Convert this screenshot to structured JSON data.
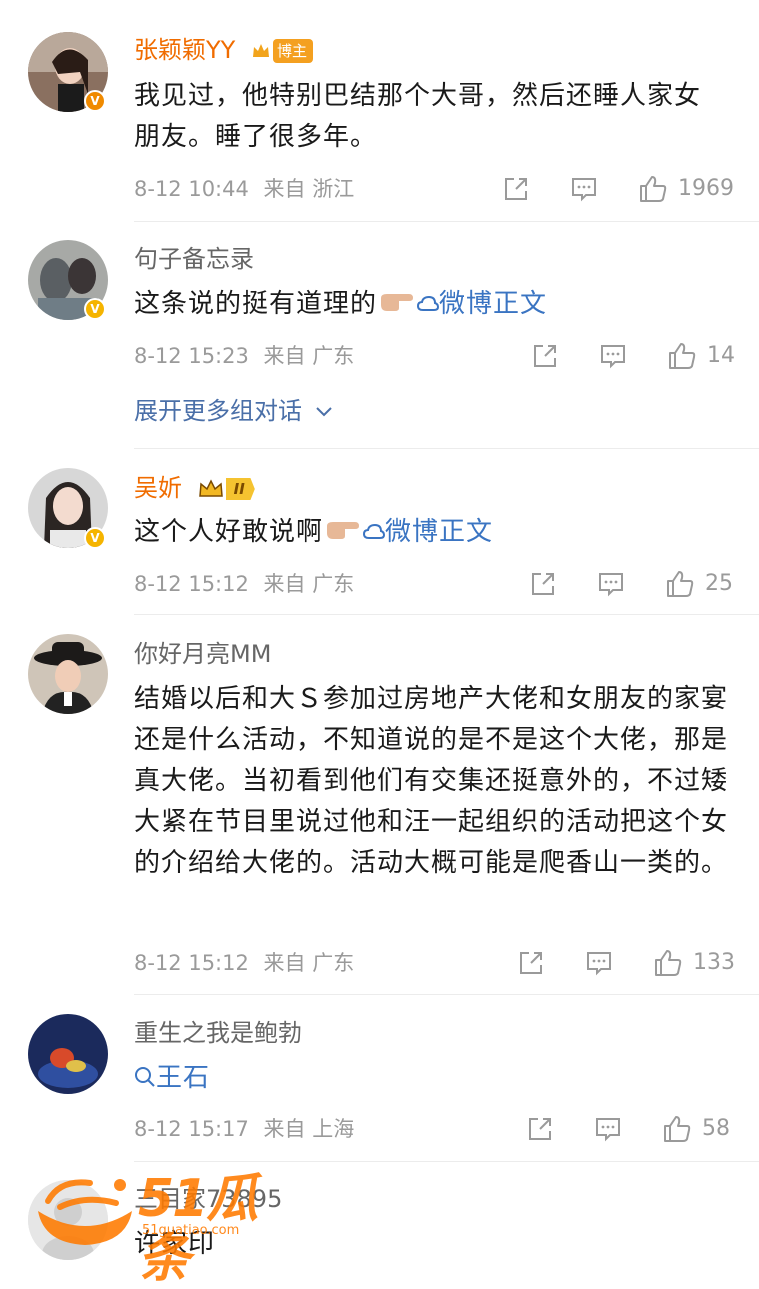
{
  "comments": [
    {
      "name": "张颖颖YY",
      "badge_tag": "博主",
      "text": "我见过，他特别巴结那个大哥，然后还睡人家女朋友。睡了很多年。",
      "time": "8-12 10:44",
      "source": "来自 浙江",
      "likes": "1969"
    },
    {
      "name": "句子备忘录",
      "text": "这条说的挺有道理的",
      "link_label": "微博正文",
      "time": "8-12 15:23",
      "source": "来自 广东",
      "likes": "14",
      "expand_label": "展开更多组对话"
    },
    {
      "name": "吴妡",
      "level_tag": "II",
      "text": "这个人好敢说啊",
      "link_label": "微博正文",
      "time": "8-12 15:12",
      "source": "来自 广东",
      "likes": "25"
    },
    {
      "name": "你好月亮MM",
      "text": "结婚以后和大Ｓ参加过房地产大佬和女朋友的家宴还是什么活动，不知道说的是不是这个大佬，那是真大佬。当初看到他们有交集还挺意外的，不过矮大紧在节目里说过他和汪一起组织的活动把这个女的介绍给大佬的。活动大概可能是爬香山一类的。",
      "time": "8-12 15:12",
      "source": "来自 广东",
      "likes": "133"
    },
    {
      "name": "重生之我是鲍勃",
      "search_link": "王石",
      "time": "8-12 15:17",
      "source": "来自 上海",
      "likes": "58"
    },
    {
      "name": "三目家73895",
      "text": "许家印"
    }
  ],
  "watermark": {
    "logo_text": "51瓜条",
    "url": "51guatiao.com"
  },
  "colors": {
    "orange_name": "#f06c00",
    "link_blue": "#3a74c2",
    "meta_gray": "#9a9a9a"
  }
}
